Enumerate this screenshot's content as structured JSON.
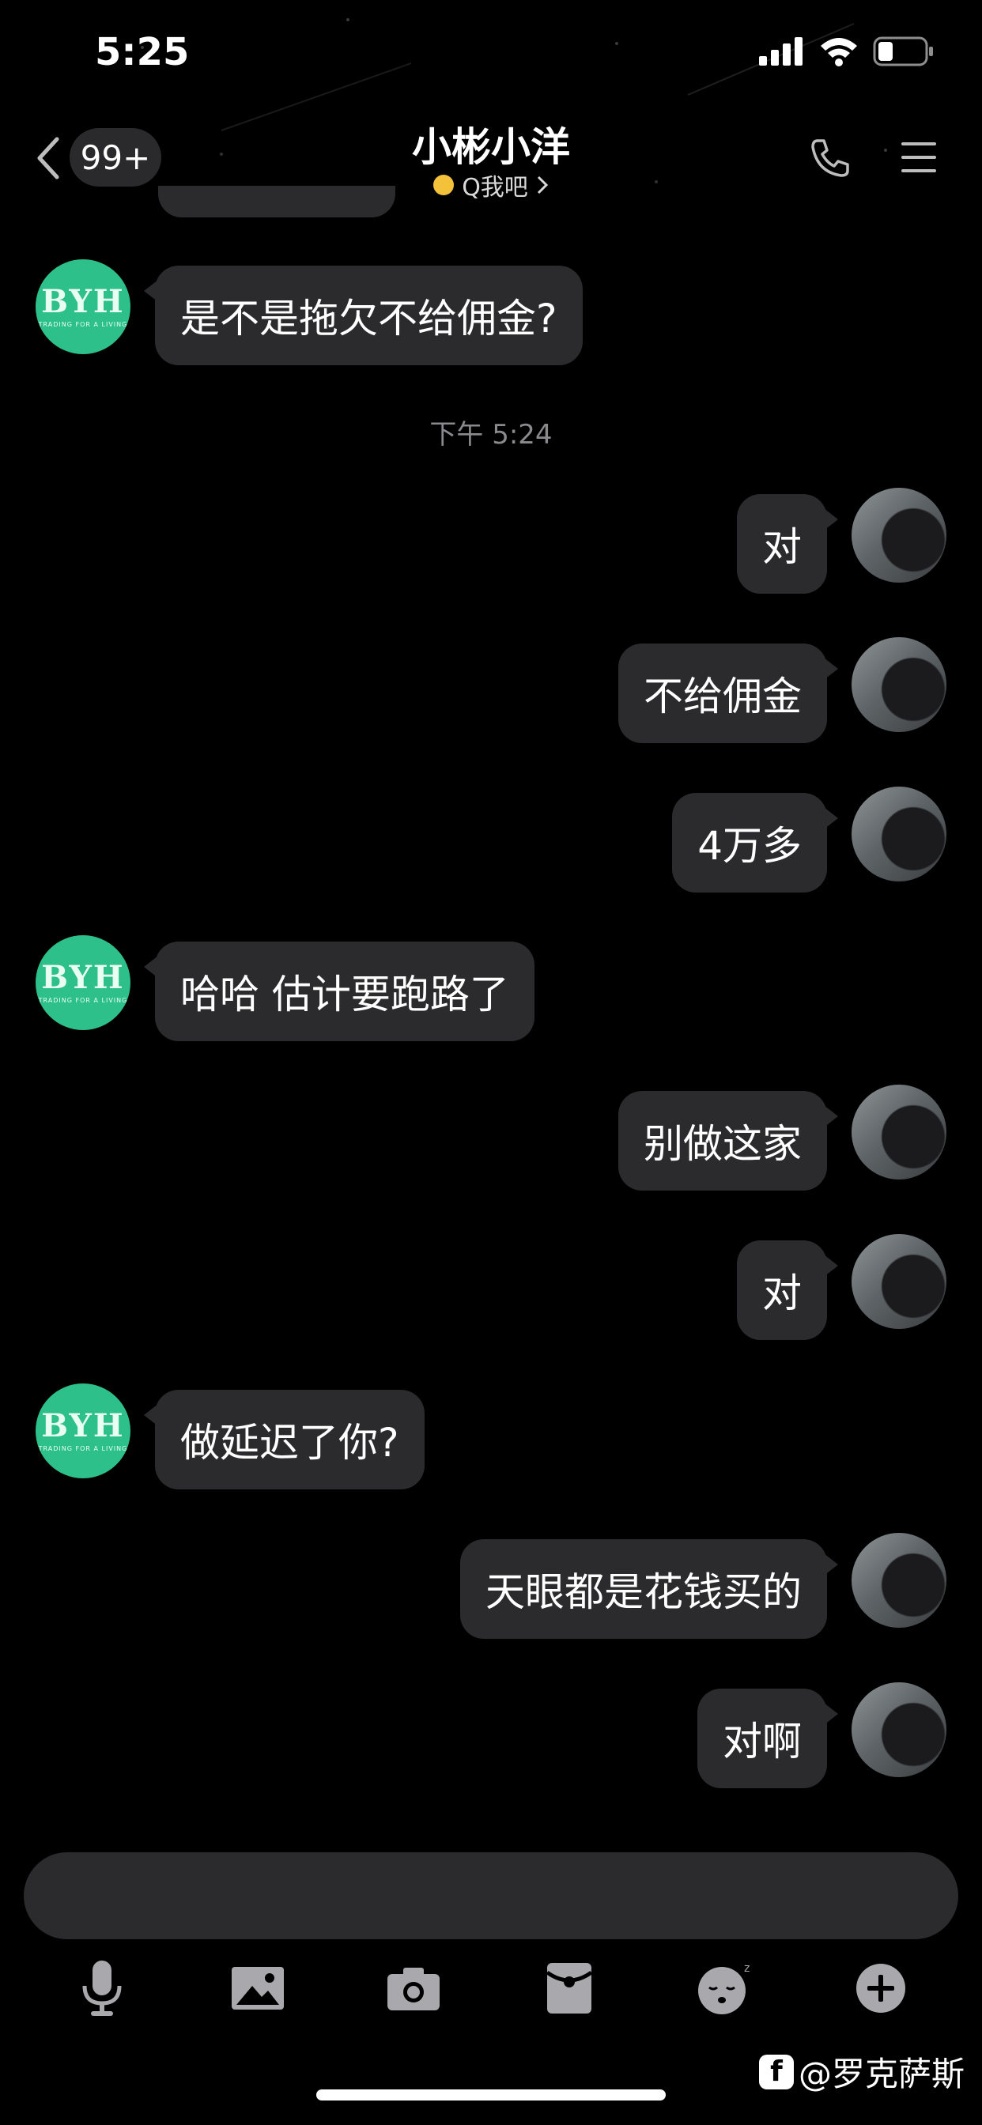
{
  "status_bar": {
    "time": "5:25"
  },
  "nav": {
    "unread_badge": "99+",
    "title": "小彬小洋",
    "subtitle": "Q我吧"
  },
  "messages": [
    {
      "side": "in",
      "text": "是不是拖欠不给佣金?"
    },
    {
      "side": "timestamp",
      "text": "下午 5:24"
    },
    {
      "side": "out",
      "text": "对"
    },
    {
      "side": "out",
      "text": "不给佣金"
    },
    {
      "side": "out",
      "text": "4万多"
    },
    {
      "side": "in",
      "text": "哈哈 估计要跑路了"
    },
    {
      "side": "out",
      "text": "别做这家"
    },
    {
      "side": "out",
      "text": "对"
    },
    {
      "side": "in",
      "text": "做延迟了你?"
    },
    {
      "side": "out",
      "text": "天眼都是花钱买的"
    },
    {
      "side": "out",
      "text": "对啊"
    }
  ],
  "avatar_logo": {
    "main": "BYH",
    "sub": "TRADING FOR A LIVING"
  },
  "toolbar_icons": [
    "microphone-icon",
    "image-icon",
    "camera-icon",
    "red-packet-icon",
    "emoji-icon",
    "plus-icon"
  ],
  "watermark": "@罗克萨斯",
  "colors": {
    "background": "#000000",
    "bubble": "#2b2b2d",
    "bot_avatar": "#2ec08a",
    "timestamp": "#8a8a8e"
  }
}
